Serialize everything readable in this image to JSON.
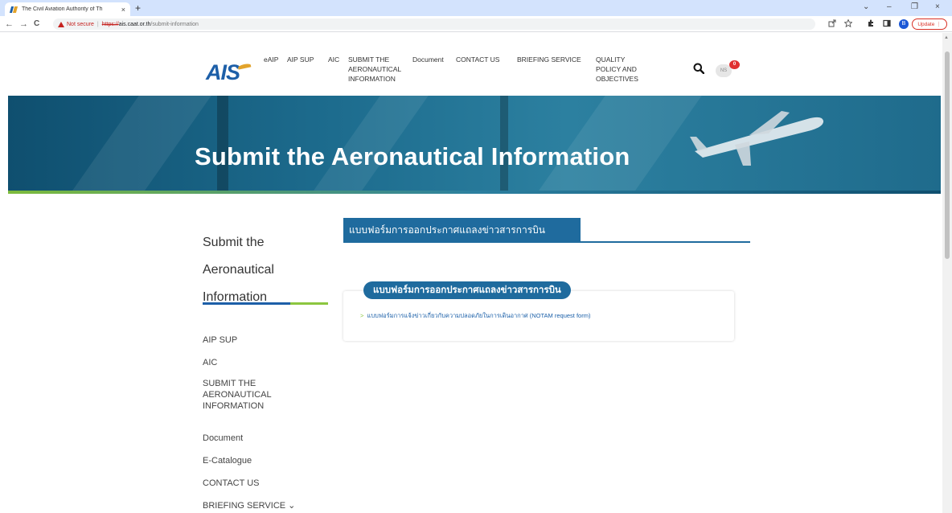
{
  "browser": {
    "tab_title": "The Civil Aviation Authority of Th",
    "tab_close": "×",
    "new_tab": "+",
    "win_minimize_chevron": "⌄",
    "win_minimize": "–",
    "win_restore": "❐",
    "win_close": "×",
    "back": "←",
    "forward": "→",
    "reload": "C",
    "not_secure": "Not secure",
    "url_separator": "|",
    "url_scheme": "https://",
    "url_host": "ais.caat.or.th",
    "url_path": "/submit-information",
    "profile_initial": "B",
    "update_label": "Update"
  },
  "site": {
    "logo_text": "AIS",
    "menu": [
      {
        "label": "eAIP"
      },
      {
        "label": "AIP SUP"
      },
      {
        "label": "AIC"
      },
      {
        "label": "SUBMIT THE\nAERONAUTICAL\nINFORMATION"
      },
      {
        "label": "Document"
      },
      {
        "label": "CONTACT US"
      },
      {
        "label": "BRIEFING SERVICE"
      },
      {
        "label": "QUALITY\nPOLICY AND\nOBJECTIVES"
      }
    ],
    "user_initials": "NS",
    "user_count": "0"
  },
  "hero": {
    "title": "Submit the Aeronautical Information"
  },
  "sidebar": {
    "title": "Submit the\nAeronautical\nInformation",
    "items": [
      {
        "label": "AIP SUP"
      },
      {
        "label": "AIC"
      },
      {
        "label": "SUBMIT THE\nAERONAUTICAL\nINFORMATION"
      },
      {
        "label": "Document"
      },
      {
        "label": "E-Catalogue"
      },
      {
        "label": "CONTACT US"
      },
      {
        "label": "BRIEFING SERVICE ⌄"
      }
    ]
  },
  "content": {
    "tab_label": "แบบฟอร์มการออกประกาศแถลงข่าวสารการบิน",
    "card_title": "แบบฟอร์มการออกประกาศแถลงข่าวสารการบิน",
    "link_arrow": ">",
    "link_text": "แบบฟอร์มการแจ้งข่าวเกี่ยวกับความปลอดภัยในการเดินอากาศ (NOTAM request form)"
  },
  "colors": {
    "brand_blue": "#1f6b9e",
    "accent_green": "#8cc63f",
    "warning_red": "#c5221f"
  }
}
